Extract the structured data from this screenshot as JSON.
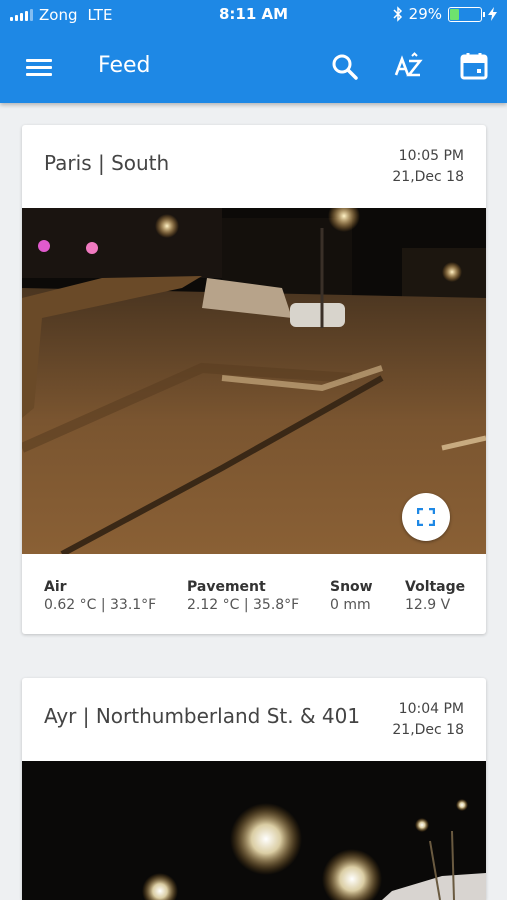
{
  "status": {
    "carrier": "Zong",
    "network": "LTE",
    "time": "8:11 AM",
    "battery": "29%",
    "battery_level": 0.29
  },
  "toolbar": {
    "title": "Feed"
  },
  "icons": {
    "menu": "menu-icon",
    "search": "search-icon",
    "sort": "sort-az-icon",
    "calendar": "calendar-icon",
    "expand": "fullscreen-icon"
  },
  "colors": {
    "appbar": "#1e88e5",
    "background": "#eef0f2",
    "expand_icon": "#1e88e5"
  },
  "feed": [
    {
      "title": "Paris | South",
      "time": "10:05 PM",
      "date": "21,Dec 18",
      "stats": [
        {
          "label": "Air",
          "value": "0.62 °C | 33.1°F"
        },
        {
          "label": "Pavement",
          "value": "2.12 °C | 35.8°F"
        },
        {
          "label": "Snow",
          "value": "0 mm"
        },
        {
          "label": "Voltage",
          "value": "12.9 V"
        }
      ]
    },
    {
      "title": "Ayr | Northumberland St. & 401",
      "time": "10:04 PM",
      "date": "21,Dec 18"
    }
  ]
}
